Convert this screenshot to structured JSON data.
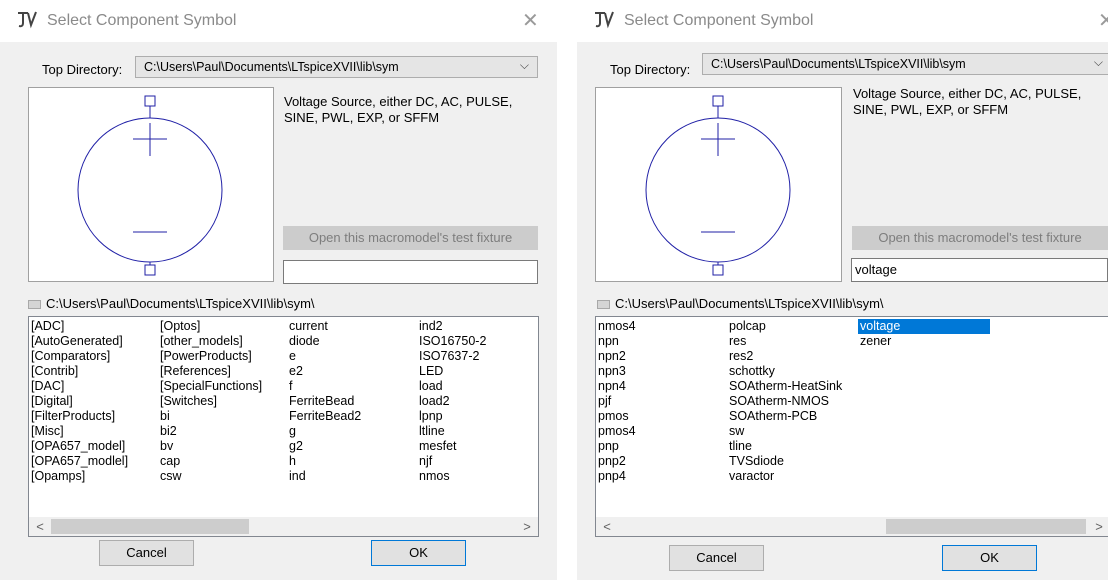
{
  "left": {
    "title": "Select Component Symbol",
    "top_dir_label": "Top Directory:",
    "top_dir_value": "C:\\Users\\Paul\\Documents\\LTspiceXVII\\lib\\sym",
    "description": "Voltage Source, either DC, AC, PULSE, SINE, PWL, EXP, or SFFM",
    "fixture_button": "Open this macromodel's test fixture",
    "search_value": "",
    "path": "C:\\Users\\Paul\\Documents\\LTspiceXVII\\lib\\sym\\",
    "columns": [
      [
        "[ADC]",
        "[AutoGenerated]",
        "[Comparators]",
        "[Contrib]",
        "[DAC]",
        "[Digital]",
        "[FilterProducts]",
        "[Misc]",
        "[OPA657_model]",
        "[OPA657_modlel]",
        "[Opamps]"
      ],
      [
        "[Optos]",
        "[other_models]",
        "[PowerProducts]",
        "[References]",
        "[SpecialFunctions]",
        "[Switches]",
        "bi",
        "bi2",
        "bv",
        "cap",
        "csw"
      ],
      [
        "current",
        "diode",
        "e",
        "e2",
        "f",
        "FerriteBead",
        "FerriteBead2",
        "g",
        "g2",
        "h",
        "ind"
      ],
      [
        "ind2",
        "ISO16750-2",
        "ISO7637-2",
        "LED",
        "load",
        "load2",
        "lpnp",
        "ltline",
        "mesfet",
        "njf",
        "nmos"
      ]
    ],
    "cancel": "Cancel",
    "ok": "OK"
  },
  "right": {
    "title": "Select Component Symbol",
    "top_dir_label": "Top Directory:",
    "top_dir_value": "C:\\Users\\Paul\\Documents\\LTspiceXVII\\lib\\sym",
    "description": "Voltage Source, either DC, AC, PULSE, SINE, PWL, EXP, or SFFM",
    "fixture_button": "Open this macromodel's test fixture",
    "search_value": "voltage",
    "path": "C:\\Users\\Paul\\Documents\\LTspiceXVII\\lib\\sym\\",
    "columns": [
      [
        "nmos4",
        "npn",
        "npn2",
        "npn3",
        "npn4",
        "pjf",
        "pmos",
        "pmos4",
        "pnp",
        "pnp2",
        "pnp4"
      ],
      [
        "polcap",
        "res",
        "res2",
        "schottky",
        "SOAtherm-HeatSink",
        "SOAtherm-NMOS",
        "SOAtherm-PCB",
        "sw",
        "tline",
        "TVSdiode",
        "varactor"
      ],
      [
        "voltage",
        "zener"
      ]
    ],
    "selected_item": "voltage",
    "cancel": "Cancel",
    "ok": "OK"
  },
  "colors": {
    "symbol_stroke": "#1f1fa6",
    "selection": "#0078d7",
    "dialog_bg": "#f0f0f0"
  },
  "icons": {
    "title": "ltspice-app-icon",
    "close": "close-icon",
    "dropdown": "chevron-down-icon",
    "folder": "folder-icon"
  }
}
